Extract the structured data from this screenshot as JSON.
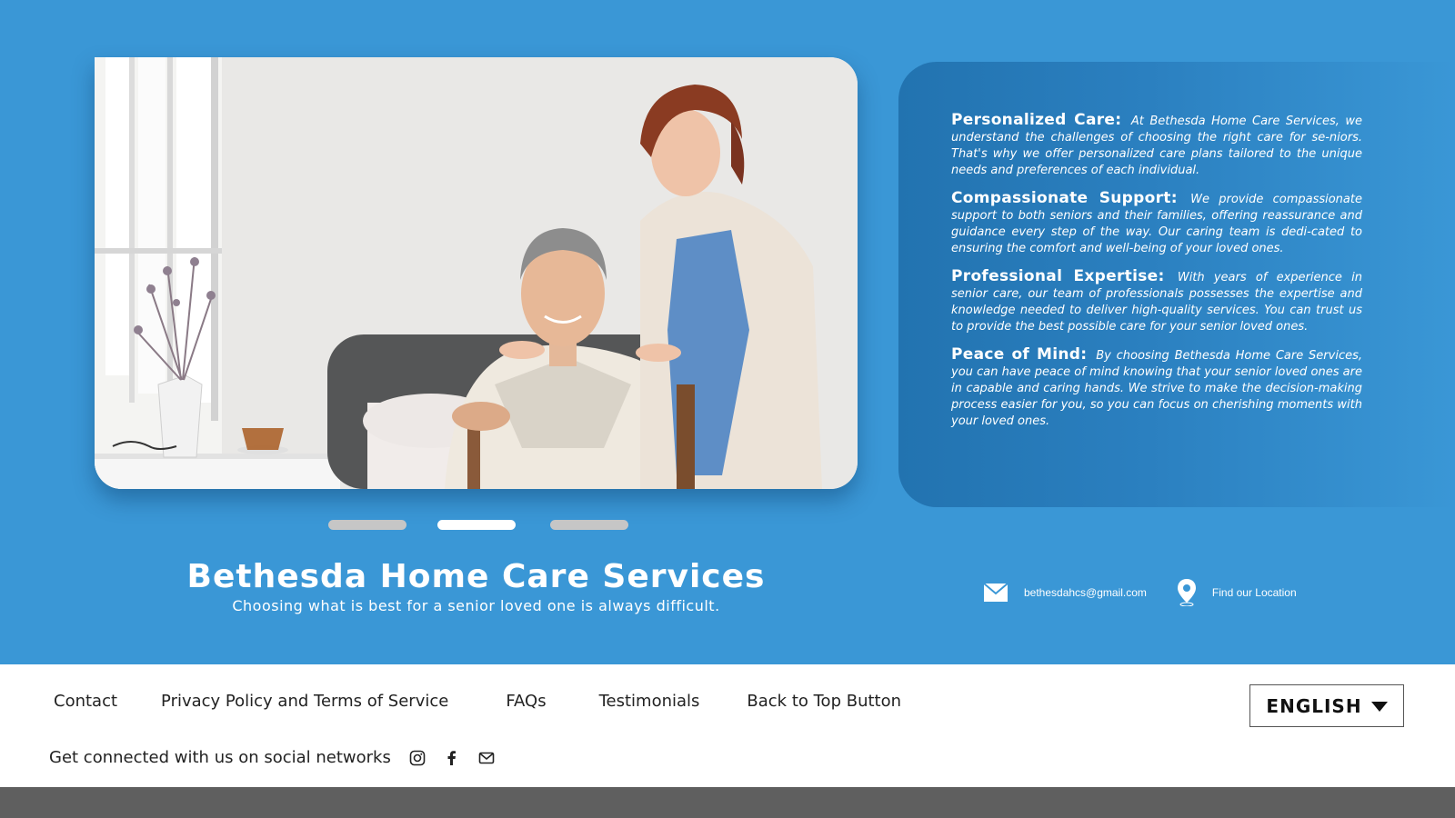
{
  "brand": {
    "title": "Bethesda Home Care Services",
    "subtitle": "Choosing what is best for a senior loved one is always difficult."
  },
  "carousel": {
    "slide_count": 3,
    "active_index": 1
  },
  "features": [
    {
      "title": "Personalized Care:",
      "body": "At Bethesda Home Care Services, we understand the challenges of choosing the right care for se-niors. That's why we offer personalized care plans tailored to the unique needs and preferences of each individual."
    },
    {
      "title": "Compassionate Support:",
      "body": "We provide compassionate support to both seniors and their families, offering reassurance and guidance every step of the way. Our caring team is dedi-cated to ensuring the comfort and well-being of your loved ones."
    },
    {
      "title": "Professional Expertise:",
      "body": "With years of experience in senior care, our team of professionals possesses the expertise and knowledge needed to deliver high-quality services. You can trust us to provide the best possible care for your senior loved ones."
    },
    {
      "title": "Peace of Mind:",
      "body": "By choosing Bethesda Home Care Services, you can have peace of mind knowing that your senior loved ones are in capable and caring hands. We strive to make the decision-making process easier for you, so you can focus on cherishing moments with your loved ones."
    }
  ],
  "contact": {
    "email": "bethesdahcs@gmail.com",
    "location_label": "Find our Location"
  },
  "footer": {
    "nav": [
      "Contact",
      "Privacy Policy and Terms of Service",
      "FAQs",
      "Testimonials",
      "Back to Top Button"
    ],
    "social_text": "Get connected with us on social networks",
    "language": "ENGLISH"
  },
  "colors": {
    "hero_bg": "#3a97d6",
    "panel_dark": "#2273b0",
    "footer_bg": "#ffffff",
    "bottom_bar": "#5f5f5f"
  },
  "icons": [
    "mail-icon",
    "location-pin-icon",
    "instagram-icon",
    "facebook-icon",
    "email-icon",
    "caret-down-icon"
  ]
}
